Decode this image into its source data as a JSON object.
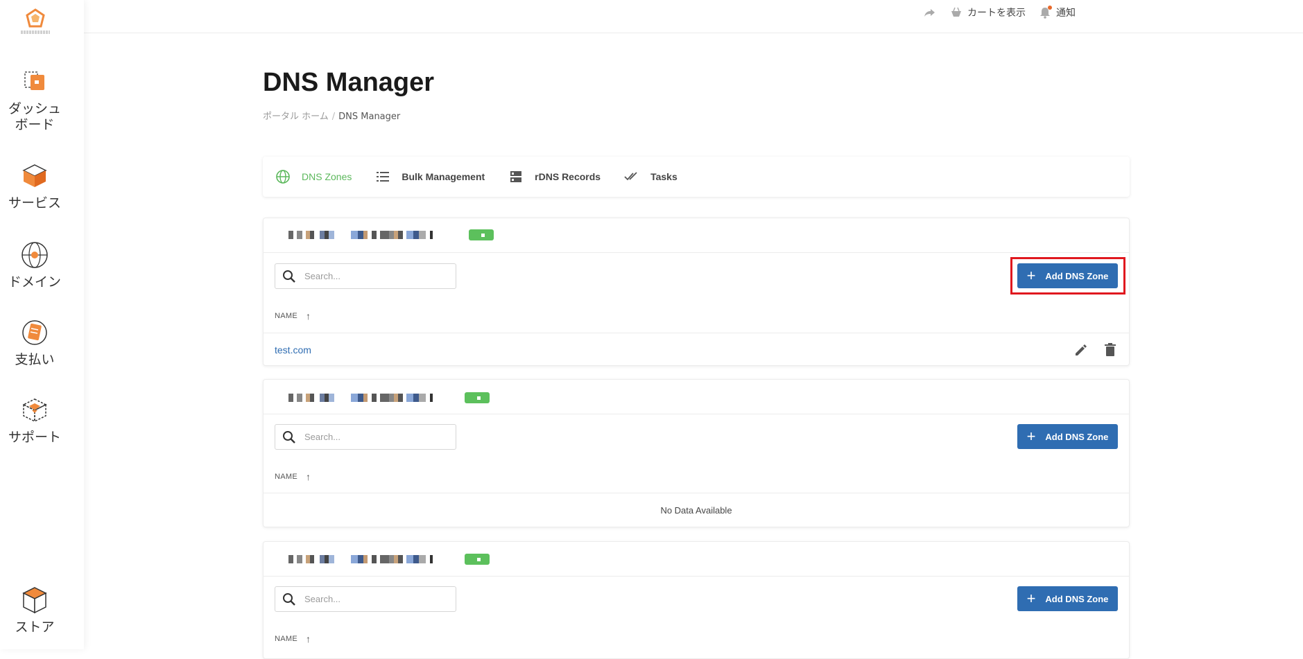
{
  "sidebar": {
    "items": [
      {
        "label": "ダッシュボード",
        "icon": "dashboard-icon"
      },
      {
        "label": "サービス",
        "icon": "services-icon"
      },
      {
        "label": "ドメイン",
        "icon": "domain-globe-icon"
      },
      {
        "label": "支払い",
        "icon": "billing-icon"
      },
      {
        "label": "サポート",
        "icon": "support-icon"
      },
      {
        "label": "ストア",
        "icon": "store-icon"
      }
    ]
  },
  "topbar": {
    "cart_label": "カートを表示",
    "notify_label": "通知"
  },
  "page": {
    "title": "DNS Manager",
    "breadcrumb_home": "ポータル ホーム",
    "breadcrumb_sep": "/",
    "breadcrumb_current": "DNS Manager"
  },
  "tabs": [
    {
      "label": "DNS Zones",
      "icon": "globe-icon",
      "active": true
    },
    {
      "label": "Bulk Management",
      "icon": "list-icon",
      "active": false
    },
    {
      "label": "rDNS Records",
      "icon": "server-icon",
      "active": false
    },
    {
      "label": "Tasks",
      "icon": "double-check-icon",
      "active": false
    }
  ],
  "panels": [
    {
      "search_placeholder": "Search...",
      "add_label": "Add DNS Zone",
      "column": "NAME",
      "rows": [
        "test.com"
      ],
      "empty_text": ""
    },
    {
      "search_placeholder": "Search...",
      "add_label": "Add DNS Zone",
      "column": "NAME",
      "rows": [],
      "empty_text": "No Data Available"
    },
    {
      "search_placeholder": "Search...",
      "add_label": "Add DNS Zone",
      "column": "NAME",
      "rows": [],
      "empty_text": ""
    }
  ],
  "colors": {
    "accent": "#2f6db2",
    "active_tab": "#5cb85c",
    "highlight": "#e0181e",
    "brand_orange": "#e8692b"
  }
}
